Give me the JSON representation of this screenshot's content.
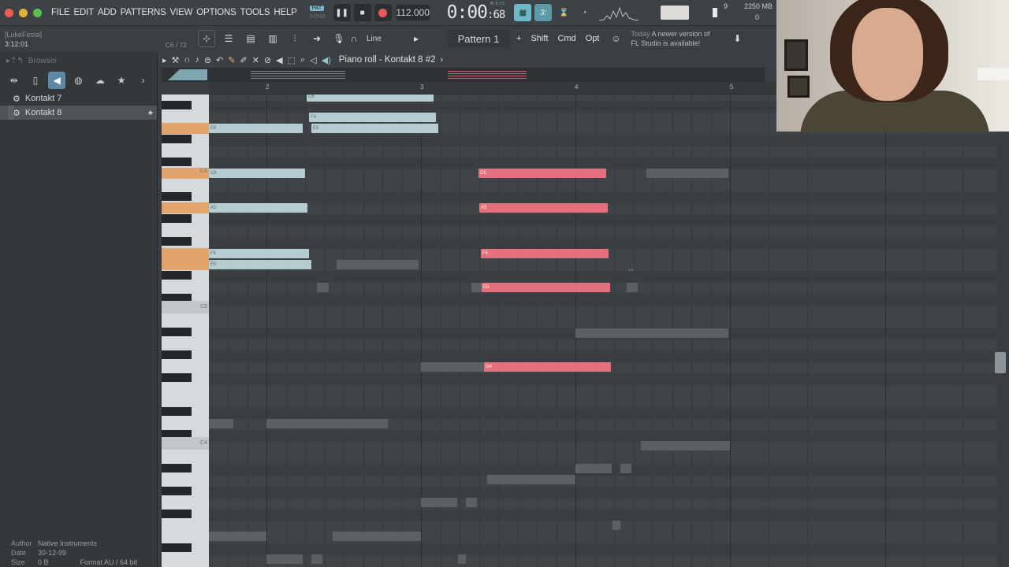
{
  "menu": {
    "items": [
      "FILE",
      "EDIT",
      "ADD",
      "PATTERNS",
      "VIEW",
      "OPTIONS",
      "TOOLS",
      "HELP"
    ],
    "pat_label": "PAT",
    "song_label": "SONG",
    "tempo": "112.000",
    "time_main": "0:00",
    "time_fraction": ":68",
    "time_units": "M:S:CS",
    "cpu_value": "9",
    "memory": "2250 MB",
    "polyphony": "0"
  },
  "toolbar2": {
    "user": "[LukeFesta]",
    "position": "3:12:01",
    "note_hint": "C6 / 72",
    "snap": "Line",
    "pattern": "Pattern 1",
    "plus": "+",
    "shift": "Shift",
    "cmd": "Cmd",
    "opt": "Opt",
    "news_when": "Today",
    "news_line1": "A newer version of",
    "news_line2": "FL Studio is available!"
  },
  "browser": {
    "title": "Browser",
    "items": [
      {
        "label": "Kontakt 7",
        "active": false
      },
      {
        "label": "Kontakt 8",
        "active": true
      }
    ],
    "info": {
      "author_key": "Author",
      "author": "Native Instruments",
      "date_key": "Date",
      "date": "30-12-99",
      "size_key": "Size",
      "size": "0 B",
      "format_key": "Format",
      "format": "AU / 64 bit"
    }
  },
  "piano_roll": {
    "title": "Piano roll - Kontakt 8 #2",
    "bars": [
      "2",
      "3",
      "4",
      "5"
    ],
    "key_labels": [
      "C6",
      "C5",
      "C4"
    ],
    "notes": [
      {
        "label": "G6",
        "color": "teal"
      },
      {
        "label": "F6",
        "color": "teal"
      },
      {
        "label": "E6",
        "color": "teal"
      },
      {
        "label": "E6",
        "color": "teal"
      },
      {
        "label": "C6",
        "color": "teal"
      },
      {
        "label": "A5",
        "color": "teal"
      },
      {
        "label": "F5",
        "color": "teal"
      },
      {
        "label": "E5",
        "color": "teal"
      },
      {
        "label": "C6",
        "color": "red"
      },
      {
        "label": "A5",
        "color": "red"
      },
      {
        "label": "F5",
        "color": "red"
      },
      {
        "label": "D5",
        "color": "red"
      },
      {
        "label": "G4",
        "color": "red"
      }
    ]
  },
  "colors": {
    "accent": "#e3707c",
    "ghost_teal": "#b5ccd0",
    "key_highlight": "#e0a46c"
  }
}
